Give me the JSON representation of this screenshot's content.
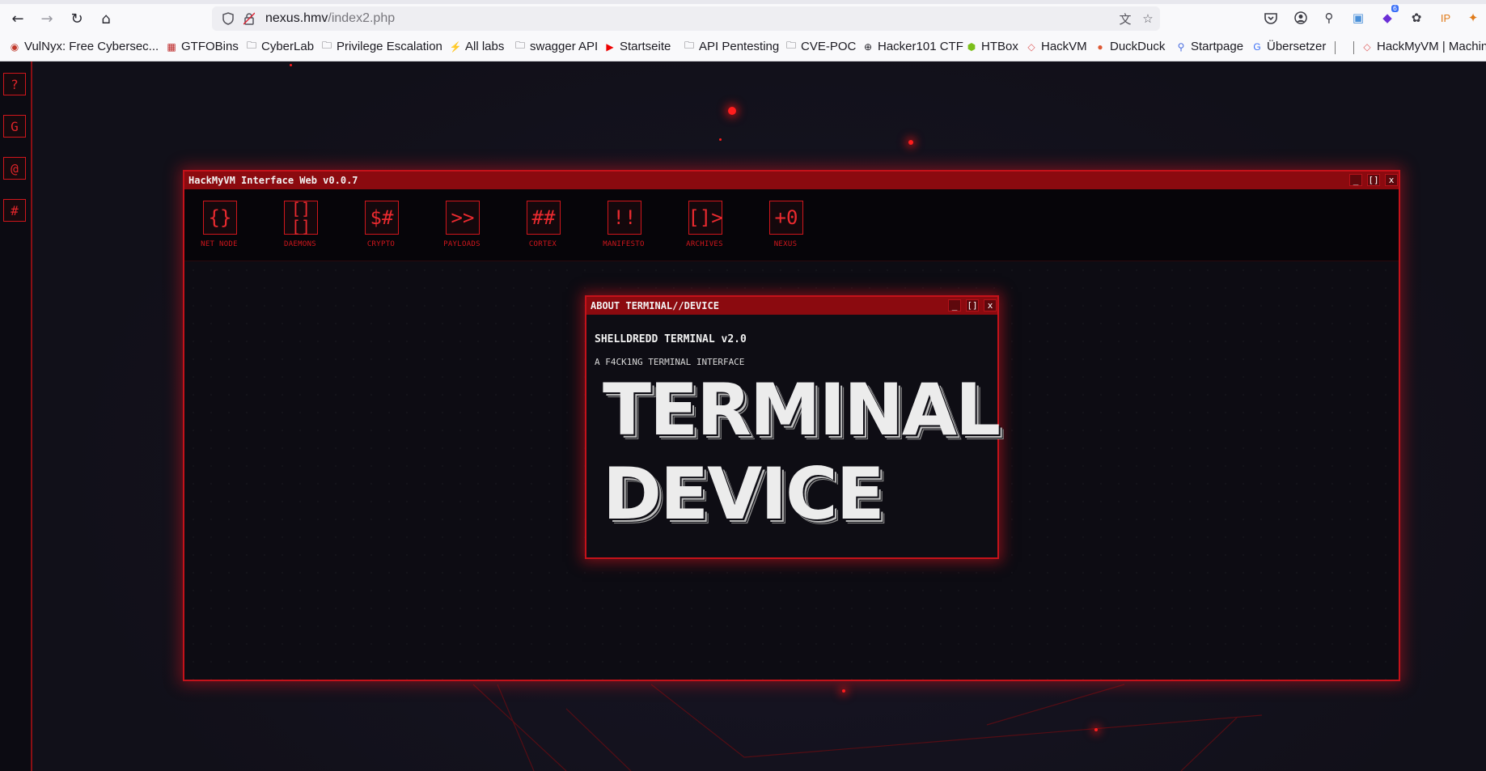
{
  "browser": {
    "url_host": "nexus.hmv",
    "url_path": "/index2.php",
    "nav": {
      "back": "←",
      "forward": "→",
      "reload": "↻",
      "home": "⌂"
    },
    "bookmarks": [
      {
        "label": "VulNyx: Free Cybersec...",
        "icon": "vulnyx-icon"
      },
      {
        "label": "GTFOBins",
        "icon": "gtfobins-icon"
      },
      {
        "label": "CyberLab",
        "icon": "folder-icon"
      },
      {
        "label": "Privilege Escalation",
        "icon": "folder-icon"
      },
      {
        "label": "All labs",
        "icon": "portswigger-icon"
      },
      {
        "label": "swagger API",
        "icon": "folder-icon"
      },
      {
        "label": "Startseite",
        "icon": "youtube-icon"
      },
      {
        "label": "API Pentesting",
        "icon": "folder-icon"
      },
      {
        "label": "CVE-POC",
        "icon": "folder-icon"
      },
      {
        "label": "Hacker101 CTF",
        "icon": "globe-icon"
      },
      {
        "label": "HTBox",
        "icon": "htb-icon"
      },
      {
        "label": "HackVM",
        "icon": "hackmyvm-icon"
      },
      {
        "label": "DuckDuck",
        "icon": "duckduckgo-icon"
      },
      {
        "label": "Startpage",
        "icon": "startpage-icon"
      },
      {
        "label": "Übersetzer",
        "icon": "translate-icon"
      },
      {
        "label": "HackMyVM | Machine",
        "icon": "hackmyvm-icon"
      }
    ],
    "badge_count": "6",
    "ip_label": "IP"
  },
  "sidebar": {
    "buttons": [
      "?",
      "G",
      "@",
      "#"
    ]
  },
  "window": {
    "title": "HackMyVM Interface Web v0.0.7",
    "controls": {
      "minimize": "_",
      "maximize": "[]",
      "close": "x"
    },
    "tools": [
      {
        "glyph": "{}",
        "label": "NET NODE"
      },
      {
        "glyph": "[]\n[]",
        "label": "DAEMONS"
      },
      {
        "glyph": "$#",
        "label": "CRYPTO"
      },
      {
        "glyph": ">>",
        "label": "PAYLOADS"
      },
      {
        "glyph": "##",
        "label": "CORTEX"
      },
      {
        "glyph": "!!",
        "label": "MANIFESTO"
      },
      {
        "glyph": "[]>",
        "label": "ARCHIVES"
      },
      {
        "glyph": "+0",
        "label": "NEXUS"
      }
    ]
  },
  "about": {
    "title": "ABOUT TERMINAL//DEVICE",
    "controls": {
      "minimize": "_",
      "maximize": "[]",
      "close": "x"
    },
    "heading": "SHELLDREDD TERMINAL v2.0",
    "subtitle": "A F4CK1NG TERMINAL INTERFACE",
    "ascii_line1": "TERMINAL",
    "ascii_line2": "DEVICE"
  },
  "colors": {
    "accent": "#c4121a",
    "title_bar": "#8b0a0f",
    "background": "#12121c"
  }
}
